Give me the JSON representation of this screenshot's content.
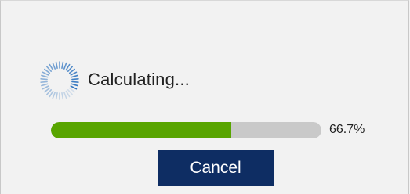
{
  "dialog": {
    "status_text": "Calculating...",
    "progress": {
      "percent_label": "66.7%",
      "value_fraction": 0.667
    },
    "cancel_label": "Cancel",
    "spinner_icon": "loading-spinner-icon"
  },
  "colors": {
    "accent_fill": "#58a500",
    "button_bg": "#0e2d63",
    "spinner": "#2f74c0"
  }
}
